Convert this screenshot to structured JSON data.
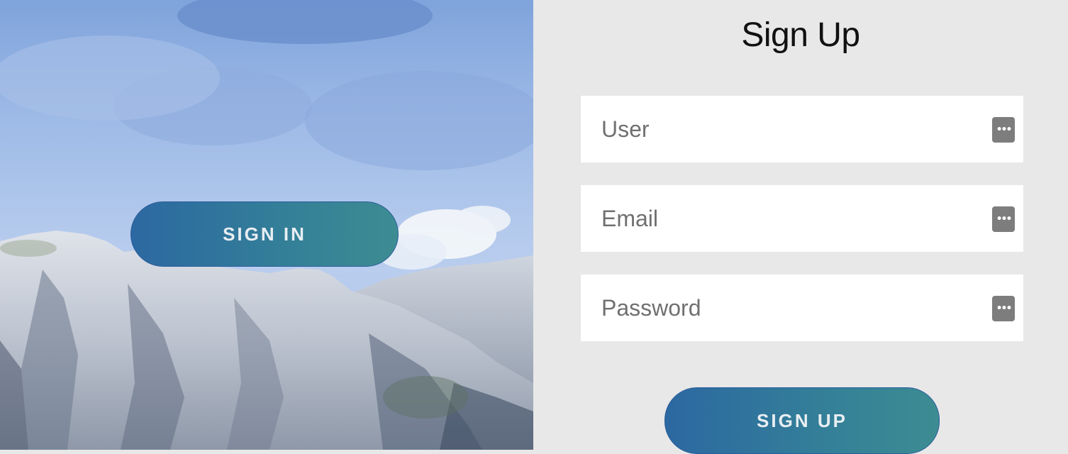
{
  "hero": {
    "sign_in_label": "SIGN IN",
    "image_subject": "mountain-landscape"
  },
  "form": {
    "title": "Sign Up",
    "fields": [
      {
        "name": "user",
        "placeholder": "User",
        "value": "",
        "icon": "password-manager-icon"
      },
      {
        "name": "email",
        "placeholder": "Email",
        "value": "",
        "icon": "password-manager-icon"
      },
      {
        "name": "password",
        "placeholder": "Password",
        "value": "",
        "icon": "password-manager-icon"
      }
    ],
    "submit_label": "SIGN UP"
  },
  "colors": {
    "panel_background": "#e8e8e8",
    "button_gradient_start": "#2c68a1",
    "button_gradient_end": "#3d8c92",
    "button_text": "#e8eef2"
  }
}
